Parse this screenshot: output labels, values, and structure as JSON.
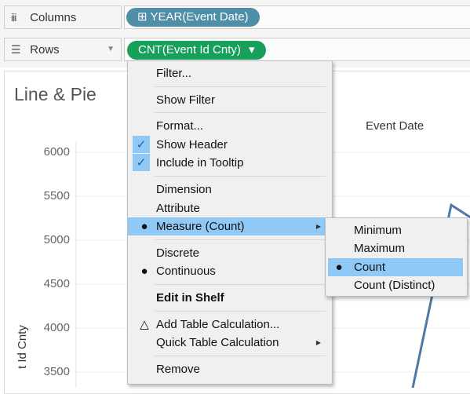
{
  "shelves": {
    "columns": {
      "label": "Columns",
      "icon": "columns-icon",
      "pill": "YEAR(Event Date)",
      "pill_prefix": "⊞"
    },
    "rows": {
      "label": "Rows",
      "icon": "rows-icon",
      "pill": "CNT(Event Id Cnty)",
      "pill_suffix": "▾"
    }
  },
  "sheet": {
    "title": "Line & Pie",
    "column_header": "Event Date",
    "y_axis_label": "t Id Cnty"
  },
  "chart_data": {
    "type": "line",
    "ylabel": "t Id Cnty",
    "xlabel": "Event Date",
    "y_ticks": [
      6000,
      5500,
      5000,
      4500,
      4000,
      3500
    ],
    "ylim": [
      3300,
      6100
    ],
    "series": [
      {
        "values": [
          {
            "x": 0,
            "y": 3150
          },
          {
            "x": 1,
            "y": 5400
          },
          {
            "x": 2,
            "y": 5200
          }
        ]
      }
    ],
    "color": "#4e79a7"
  },
  "context_menu": {
    "items": [
      {
        "label": "Filter...",
        "mark": "",
        "type": "item"
      },
      {
        "type": "sep"
      },
      {
        "label": "Show Filter",
        "mark": "",
        "type": "item"
      },
      {
        "type": "sep"
      },
      {
        "label": "Format...",
        "mark": "",
        "type": "item"
      },
      {
        "label": "Show Header",
        "mark": "✓",
        "type": "check"
      },
      {
        "label": "Include in Tooltip",
        "mark": "✓",
        "type": "check"
      },
      {
        "type": "sep"
      },
      {
        "label": "Dimension",
        "mark": "",
        "type": "item"
      },
      {
        "label": "Attribute",
        "mark": "",
        "type": "item"
      },
      {
        "label": "Measure (Count)",
        "mark": "●",
        "type": "submenu-open",
        "arrow": "▶"
      },
      {
        "type": "sep"
      },
      {
        "label": "Discrete",
        "mark": "",
        "type": "item"
      },
      {
        "label": "Continuous",
        "mark": "●",
        "type": "radio"
      },
      {
        "type": "sep"
      },
      {
        "label": "Edit in Shelf",
        "mark": "",
        "type": "bold"
      },
      {
        "type": "sep"
      },
      {
        "label": "Add Table Calculation...",
        "mark": "△",
        "type": "item"
      },
      {
        "label": "Quick Table Calculation",
        "mark": "",
        "type": "submenu",
        "arrow": "▶"
      },
      {
        "type": "sep"
      },
      {
        "label": "Remove",
        "mark": "",
        "type": "item"
      }
    ]
  },
  "measure_submenu": {
    "items": [
      {
        "label": "Minimum",
        "mark": "",
        "selected": false
      },
      {
        "label": "Maximum",
        "mark": "",
        "selected": false
      },
      {
        "label": "Count",
        "mark": "●",
        "selected": true
      },
      {
        "label": "Count (Distinct)",
        "mark": "",
        "selected": false
      }
    ]
  },
  "colors": {
    "highlight": "#90c8f6",
    "pill_dimension": "#4e8ea6",
    "pill_measure": "#16a05a",
    "line": "#4e79a7"
  }
}
